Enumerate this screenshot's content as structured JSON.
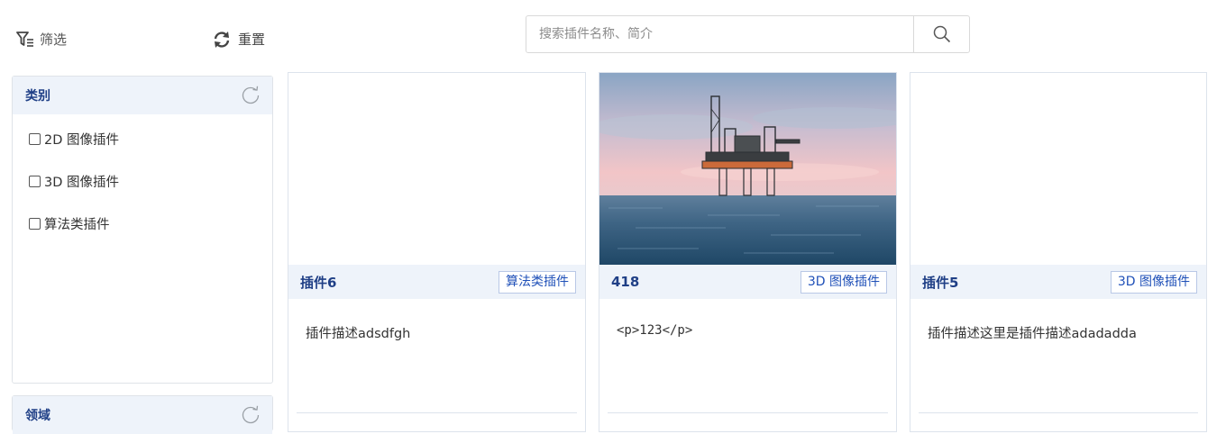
{
  "toolbar": {
    "filter_label": "筛选",
    "reset_label": "重置"
  },
  "search": {
    "placeholder": "搜索插件名称、简介",
    "value": ""
  },
  "category_panel": {
    "title": "类别",
    "options": [
      "2D 图像插件",
      "3D 图像插件",
      "算法类插件"
    ]
  },
  "domain_panel": {
    "title": "领域"
  },
  "cards": [
    {
      "title": "插件6",
      "tag": "算法类插件",
      "description": "插件描述adsdfgh",
      "has_image": false
    },
    {
      "title": "418",
      "tag": "3D 图像插件",
      "description": "<p>123</p>",
      "has_image": true,
      "image_subject": "offshore-oil-rig-at-sea"
    },
    {
      "title": "插件5",
      "tag": "3D 图像插件",
      "description": "插件描述这里是插件描述adadadda",
      "has_image": false
    }
  ],
  "colors": {
    "accent": "#1f3f86",
    "header_bg": "#eef3fa",
    "tag_text": "#1f50b8"
  }
}
